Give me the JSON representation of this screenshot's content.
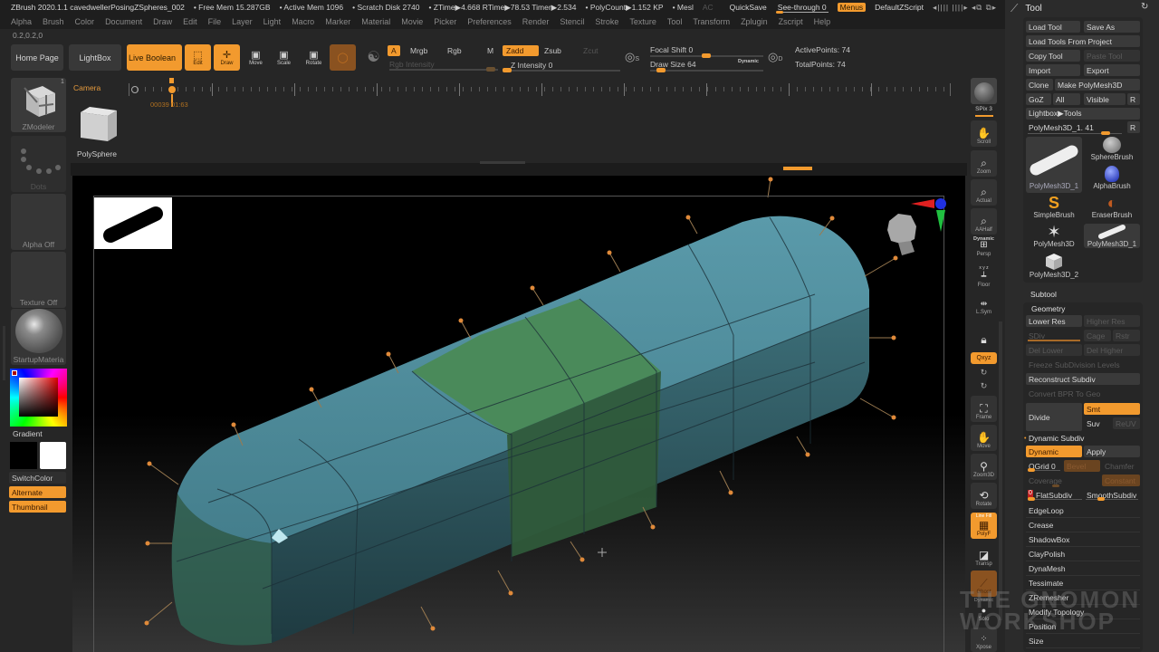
{
  "titlebar": {
    "app": "ZBrush 2020.1.1 cavedwellerPosingZSpheres_002",
    "free_mem": "• Free Mem 15.287GB",
    "active_mem": "• Active Mem 1096",
    "scratch": "• Scratch Disk 2740",
    "ztime": "• ZTime▶4.668 RTime▶78.53 Timer▶2.534",
    "polycount": "• PolyCount▶1.152 KP",
    "mesh": "• Mesl",
    "ac": "AC",
    "quicksave": "QuickSave",
    "see_through": "See-through  0",
    "menus": "Menus",
    "script": "DefaultZScript",
    "arrows": "◂||||  ||||▸   ◂⧉  ⧉▸"
  },
  "menubar": [
    "Alpha",
    "Brush",
    "Color",
    "Document",
    "Draw",
    "Edit",
    "File",
    "Layer",
    "Light",
    "Macro",
    "Marker",
    "Material",
    "Movie",
    "Picker",
    "Preferences",
    "Render",
    "Stencil",
    "Stroke",
    "Texture",
    "Tool",
    "Transform",
    "Zplugin",
    "Zscript",
    "Help"
  ],
  "coords": "0.2,0.2,0",
  "shelf": {
    "home_page": "Home Page",
    "lightbox": "LightBox",
    "live_boolean": "Live Boolean",
    "edit": "Edit",
    "draw": "Draw",
    "move": "Move",
    "scale": "Scale",
    "rotate": "Rotate",
    "a": "A",
    "mrgb": "Mrgb",
    "rgb": "Rgb",
    "m": "M",
    "zadd": "Zadd",
    "zsub": "Zsub",
    "zcut": "Zcut",
    "rgb_intensity": "Rgb Intensity",
    "z_intensity": "Z Intensity 0",
    "focal_shift": "Focal Shift 0",
    "draw_size": "Draw Size 64",
    "dynamic": "Dynamic",
    "active_points": "ActivePoints: 74",
    "total_points": "TotalPoints: 74",
    "s_label": "S",
    "d_label": "D"
  },
  "timeline": {
    "camera": "Camera",
    "time": "00039 01:63"
  },
  "left_panel": {
    "zmodeler": "ZModeler",
    "zmodeler_count": "1",
    "polysphere": "PolySphere",
    "dots": "Dots",
    "alpha_off": "Alpha Off",
    "texture_off": "Texture Off",
    "material": "StartupMateria",
    "gradient": "Gradient",
    "switch_color": "SwitchColor",
    "alternate": "Alternate",
    "thumbnail": "Thumbnail"
  },
  "right_bar": {
    "bpr": "BPR",
    "spix": "SPix 3",
    "scroll": "Scroll",
    "zoom": "Zoom",
    "actual": "Actual",
    "aahalf": "AAHalf",
    "dynamic": "Dynamic",
    "persp": "Persp",
    "xyz_small": "x y z",
    "floor": "Floor",
    "lsym": "L.Sym",
    "qxyz": "Qxyz",
    "frame": "Frame",
    "move": "Move",
    "zoom3d": "Zoom3D",
    "rotate": "Rotate",
    "line_fill": "Line Fill",
    "polyf": "PolyF",
    "transp": "Transp",
    "ghost": "Ghost",
    "dynamic2": "Dynamic",
    "solo": "Solo",
    "xpose": "Xpose"
  },
  "tool_palette": {
    "title": "Tool",
    "load_tool": "Load Tool",
    "save_as": "Save As",
    "load_tools_from_project": "Load Tools From Project",
    "copy_tool": "Copy Tool",
    "paste_tool": "Paste Tool",
    "import": "Import",
    "export": "Export",
    "clone": "Clone",
    "make_polymesh": "Make PolyMesh3D",
    "goz": "GoZ",
    "all": "All",
    "visible": "Visible",
    "r": "R",
    "lightbox_tools": "Lightbox▶Tools",
    "current_tool": "PolyMesh3D_1. 41",
    "brushes": [
      {
        "name": "PolyMesh3D_1",
        "icon": "capsule-icon"
      },
      {
        "name": "SphereBrush",
        "icon": "sphere-brush-icon"
      },
      {
        "name": "AlphaBrush",
        "icon": "alpha-brush-icon"
      },
      {
        "name": "SimpleBrush",
        "icon": "simple-brush-icon"
      },
      {
        "name": "EraserBrush",
        "icon": "eraser-brush-icon"
      },
      {
        "name": "PolyMesh3D",
        "icon": "star-icon"
      },
      {
        "name": "PolyMesh3D_1",
        "icon": "capsule-icon"
      },
      {
        "name": "PolyMesh3D_2",
        "icon": "cube-icon"
      }
    ],
    "subtool": "Subtool",
    "geometry": "Geometry",
    "lower_res": "Lower Res",
    "higher_res": "Higher Res",
    "sdiv": "SDiv",
    "cage": "Cage",
    "rstr": "Rstr",
    "del_lower": "Del Lower",
    "del_higher": "Del Higher",
    "freeze": "Freeze SubDivision Levels",
    "reconstruct": "Reconstruct Subdiv",
    "convert_bpr": "Convert BPR To Geo",
    "divide": "Divide",
    "smt": "Smt",
    "suv": "Suv",
    "reuv": "ReUV",
    "dynamic_subdiv": "Dynamic Subdiv",
    "dynamic": "Dynamic",
    "apply": "Apply",
    "qgrid": "QGrid 0",
    "bevel": "Bevel",
    "chamfer": "Chamfer",
    "coverage": "Coverage",
    "constant": "Constant",
    "flat_subdiv_val": "0",
    "flat_subdiv": "FlatSubdiv",
    "smooth_subdiv": "SmoothSubdiv",
    "sections": [
      "EdgeLoop",
      "Crease",
      "ShadowBox",
      "ClayPolish",
      "DynaMesh",
      "Tessimate",
      "ZRemesher",
      "Modify Topology",
      "Position",
      "Size"
    ]
  },
  "watermark": {
    "line1": "THE GNOMON",
    "line2": "WORKSHOP"
  },
  "colors": {
    "accent": "#f29a2e",
    "mesh_blue": "#4a8a9a",
    "mesh_green": "#4a8a50",
    "background": "#262626"
  }
}
